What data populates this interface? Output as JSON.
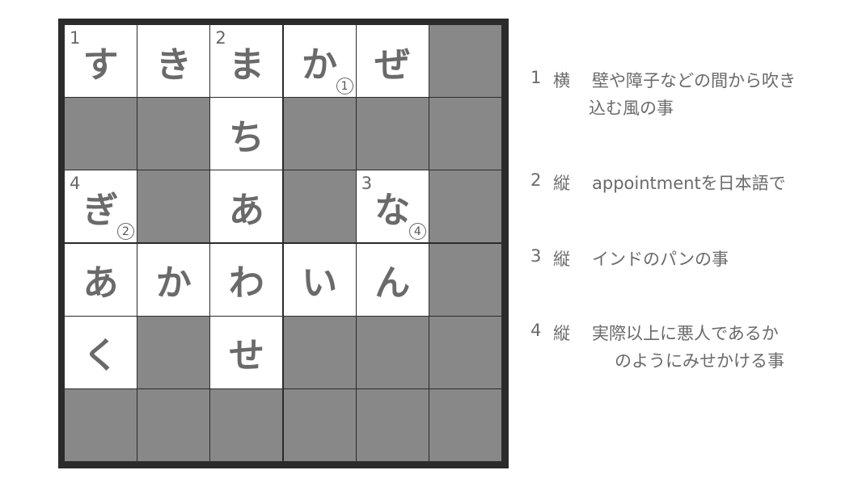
{
  "board": {
    "rows": [
      [
        {
          "t": "white",
          "ch": "す",
          "num": "1"
        },
        {
          "t": "white",
          "ch": "き"
        },
        {
          "t": "white",
          "ch": "ま",
          "num": "2"
        },
        {
          "t": "white",
          "ch": "か",
          "marker": "1"
        },
        {
          "t": "white",
          "ch": "ぜ"
        },
        {
          "t": "black"
        }
      ],
      [
        {
          "t": "black"
        },
        {
          "t": "black"
        },
        {
          "t": "white",
          "ch": "ち"
        },
        {
          "t": "black"
        },
        {
          "t": "black"
        },
        {
          "t": "black"
        }
      ],
      [
        {
          "t": "white",
          "ch": "ぎ",
          "num": "4",
          "marker": "2"
        },
        {
          "t": "black"
        },
        {
          "t": "white",
          "ch": "あ"
        },
        {
          "t": "black"
        },
        {
          "t": "white",
          "ch": "な",
          "num": "3",
          "marker": "4"
        },
        {
          "t": "black"
        }
      ],
      [
        {
          "t": "white",
          "ch": "あ"
        },
        {
          "t": "white",
          "ch": "か"
        },
        {
          "t": "white",
          "ch": "わ"
        },
        {
          "t": "white",
          "ch": "い"
        },
        {
          "t": "white",
          "ch": "ん"
        },
        {
          "t": "black"
        }
      ],
      [
        {
          "t": "white",
          "ch": "く"
        },
        {
          "t": "black"
        },
        {
          "t": "white",
          "ch": "せ"
        },
        {
          "t": "black"
        },
        {
          "t": "black"
        },
        {
          "t": "black"
        }
      ],
      [
        {
          "t": "black"
        },
        {
          "t": "black"
        },
        {
          "t": "black"
        },
        {
          "t": "black"
        },
        {
          "t": "black"
        },
        {
          "t": "black"
        }
      ]
    ],
    "colors": {
      "white": "#ffffff",
      "black": "#888888",
      "frame": "#2b2b2b",
      "text": "#6a6a6a"
    }
  },
  "markers": {
    "1": "①",
    "2": "②",
    "4": "④"
  },
  "clues": [
    {
      "num": "1",
      "dir": "横",
      "line1": "壁や障子などの間から吹き",
      "line2": "込む風の事"
    },
    {
      "num": "2",
      "dir": "縦",
      "line1": "appointmentを日本語で",
      "line2": ""
    },
    {
      "num": "3",
      "dir": "縦",
      "line1": "インドのパンの事",
      "line2": ""
    },
    {
      "num": "4",
      "dir": "縦",
      "line1": "実際以上に悪人であるか",
      "line2": "のようにみせかける事"
    }
  ]
}
